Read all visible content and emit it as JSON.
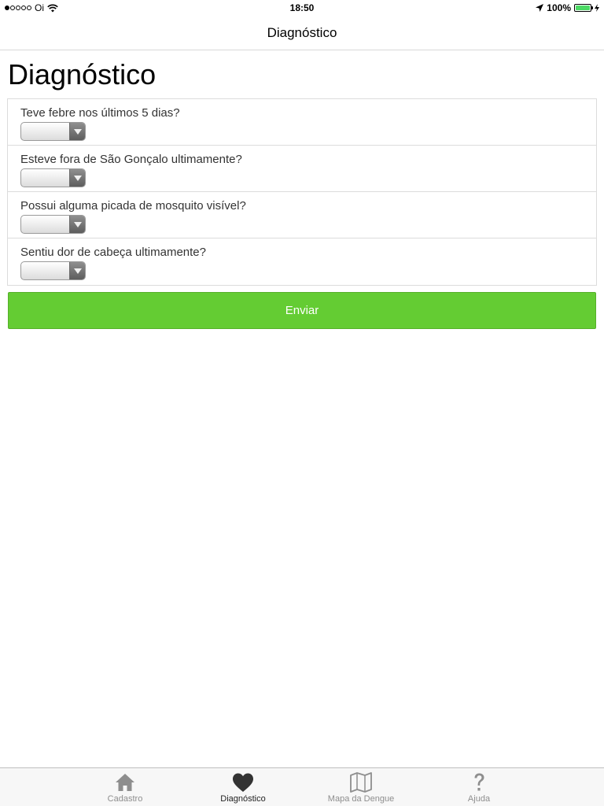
{
  "status_bar": {
    "carrier": "Oi",
    "time": "18:50",
    "battery": "100%",
    "battery_level": 1.0,
    "signal_bars": 1
  },
  "nav": {
    "title": "Diagnóstico"
  },
  "page": {
    "heading": "Diagnóstico"
  },
  "questions": [
    {
      "label": "Teve febre nos últimos 5 dias?",
      "selected": ""
    },
    {
      "label": "Esteve fora de São Gonçalo ultimamente?",
      "selected": ""
    },
    {
      "label": "Possui alguma picada de mosquito visível?",
      "selected": ""
    },
    {
      "label": "Sentiu dor de cabeça ultimamente?",
      "selected": ""
    }
  ],
  "submit_button": {
    "label": "Enviar",
    "color": "#64cc33"
  },
  "tab_bar": {
    "tabs": [
      {
        "label": "Cadastro",
        "icon": "home-icon",
        "active": false
      },
      {
        "label": "Diagnóstico",
        "icon": "heart-icon",
        "active": true
      },
      {
        "label": "Mapa da Dengue",
        "icon": "map-icon",
        "active": false
      },
      {
        "label": "Ajuda",
        "icon": "question-mark-icon",
        "active": false
      }
    ]
  }
}
